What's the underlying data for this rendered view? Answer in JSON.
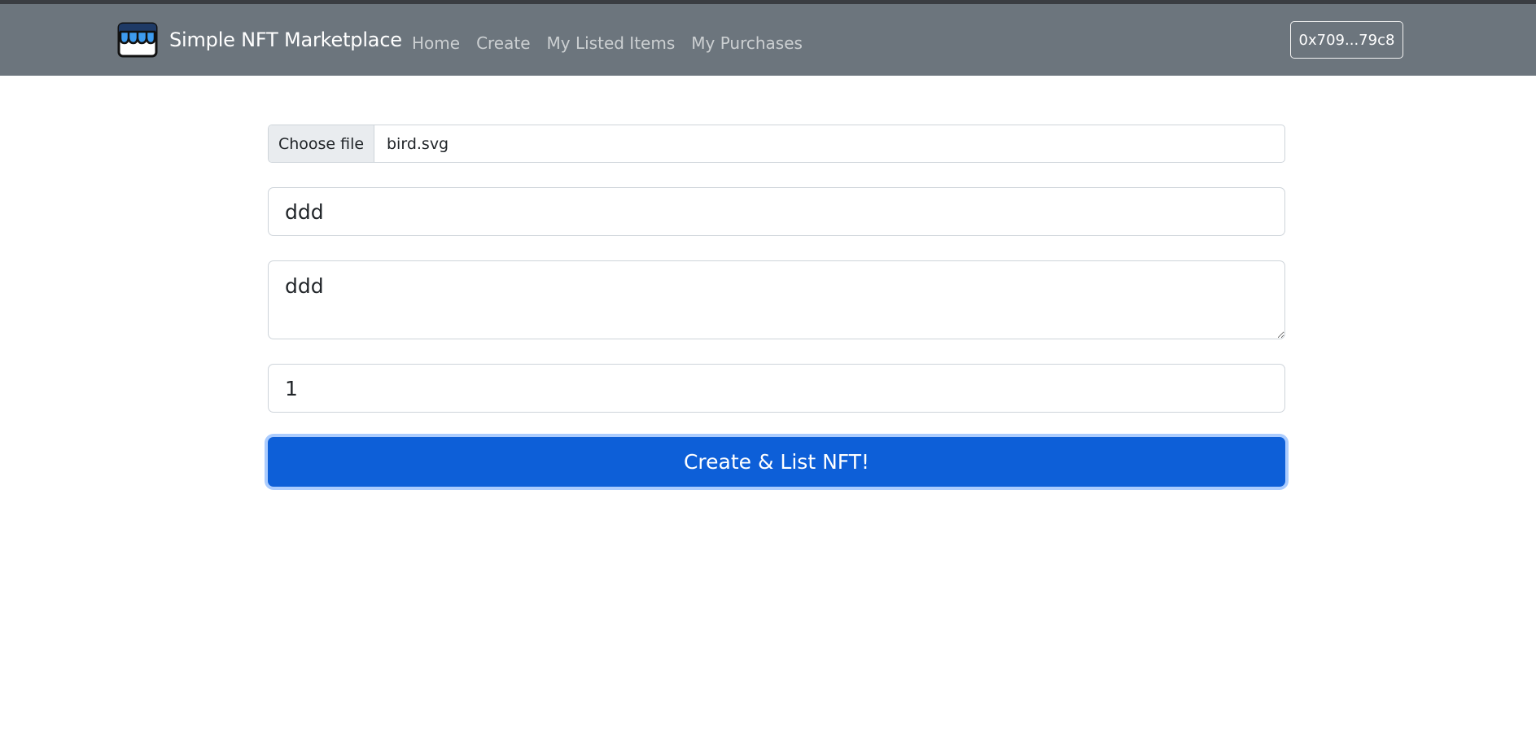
{
  "navbar": {
    "brand_name": "Simple NFT Marketplace",
    "logo_icon": "storefront-icon",
    "links": [
      "Home",
      "Create",
      "My Listed Items",
      "My Purchases"
    ],
    "account_label": "0x709...79c8",
    "background_color": "#6c757d"
  },
  "form": {
    "file_button_label": "Choose file",
    "file_name": "bird.svg",
    "name_value": "ddd",
    "description_value": "ddd",
    "price_value": "1",
    "submit_label": "Create & List NFT!",
    "submit_color": "#0d5fd8"
  }
}
